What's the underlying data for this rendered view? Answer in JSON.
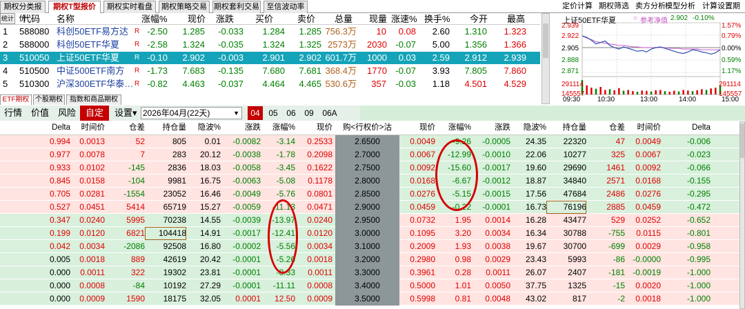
{
  "top_tabs": [
    "期权分类报价",
    "期权T型报价",
    "期权实时看盘",
    "期权策略交易",
    "期权套利交易",
    "至信波动率"
  ],
  "right_menu": [
    "定价计算",
    "期权筛选",
    "卖方分析",
    "模型分析",
    "计算设置",
    "期权交易"
  ],
  "side_tool": "统计",
  "quote_headers": [
    "代码",
    "名称",
    "涨幅%",
    "现价",
    "涨跌",
    "买价",
    "卖价",
    "总量",
    "现量",
    "涨速%",
    "换手%",
    "今开",
    "最高"
  ],
  "quote_rows": [
    {
      "idx": "1",
      "code": "588080",
      "name": "科创50ETF易方达",
      "r": "R",
      "chg_pct": "-2.50",
      "price": "1.285",
      "chg": "-0.033",
      "bid": "1.284",
      "ask": "1.285",
      "vol": "756.3万",
      "cur": "10",
      "speed": "0.08",
      "turn": "2.60",
      "open": "1.310",
      "high": "1.323"
    },
    {
      "idx": "2",
      "code": "588000",
      "name": "科创50ETF华夏",
      "r": "R",
      "chg_pct": "-2.58",
      "price": "1.324",
      "chg": "-0.035",
      "bid": "1.324",
      "ask": "1.325",
      "vol": "2573万",
      "cur": "2030",
      "speed": "-0.07",
      "turn": "5.00",
      "open": "1.356",
      "high": "1.366"
    },
    {
      "idx": "3",
      "code": "510050",
      "name": "上证50ETF华夏",
      "r": "R",
      "chg_pct": "-0.10",
      "price": "2.902",
      "chg": "-0.003",
      "bid": "2.901",
      "ask": "2.902",
      "vol": "601.7万",
      "cur": "1000",
      "speed": "0.03",
      "turn": "2.59",
      "open": "2.912",
      "high": "2.939"
    },
    {
      "idx": "4",
      "code": "510500",
      "name": "中证500ETF南方",
      "r": "R",
      "chg_pct": "-1.73",
      "price": "7.683",
      "chg": "-0.135",
      "bid": "7.680",
      "ask": "7.681",
      "vol": "368.4万",
      "cur": "1770",
      "speed": "-0.07",
      "turn": "3.93",
      "open": "7.805",
      "high": "7.860"
    },
    {
      "idx": "5",
      "code": "510300",
      "name": "沪深300ETF华泰…",
      "r": "R",
      "chg_pct": "-0.82",
      "price": "4.463",
      "chg": "-0.037",
      "bid": "4.464",
      "ask": "4.465",
      "vol": "530.6万",
      "cur": "357",
      "speed": "-0.03",
      "turn": "1.18",
      "open": "4.501",
      "high": "4.529"
    }
  ],
  "mini_chart": {
    "title": "上证50ETF华夏",
    "legend_label": "参考净值",
    "legend_value": "2.902",
    "legend_pct": "-0.10%",
    "y_left": [
      "2.939",
      "2.922",
      "2.905",
      "2.888",
      "2.871"
    ],
    "y_right": [
      "1.57%",
      "0.79%",
      "0.00%",
      "0.59%",
      "1.17%"
    ],
    "vol_left": [
      "291114",
      "145557"
    ],
    "vol_right": [
      "291114",
      "145557"
    ],
    "x_labels": [
      "09:30",
      "10:30",
      "13:00",
      "14:00",
      "15:00"
    ],
    "price_series": [
      2.921,
      2.919,
      2.915,
      2.91,
      2.912,
      2.914,
      2.908,
      2.905,
      2.903,
      2.906,
      2.904,
      2.902,
      2.9,
      2.901,
      2.899,
      2.903,
      2.905,
      2.906,
      2.904,
      2.902,
      2.9,
      2.898,
      2.897,
      2.899,
      2.902,
      2.901,
      2.899,
      2.898,
      2.896,
      2.898,
      2.902
    ],
    "avg_series": [
      2.921,
      2.918,
      2.916,
      2.913,
      2.912,
      2.911,
      2.91,
      2.909,
      2.908,
      2.908,
      2.907,
      2.906,
      2.906,
      2.905,
      2.905,
      2.905,
      2.905,
      2.905,
      2.905,
      2.904,
      2.904,
      2.904,
      2.903,
      2.903,
      2.903,
      2.903,
      2.902,
      2.902,
      2.902,
      2.902,
      2.902
    ],
    "prev_close": 2.905,
    "ymin": 2.871,
    "ymax": 2.939,
    "volume_series": [
      0.95,
      0.6,
      0.45,
      0.38,
      0.5,
      0.3,
      0.35,
      0.28,
      0.42,
      0.25,
      0.3,
      0.22,
      0.18,
      0.26,
      0.24,
      0.2,
      0.28,
      0.3,
      0.22,
      0.18,
      0.25,
      0.2,
      0.3,
      0.26,
      0.22,
      0.28,
      0.35,
      0.3,
      0.4,
      0.45,
      0.6
    ]
  },
  "bottom_tabs": [
    "ETF期权",
    "个股期权",
    "指数和商品期权"
  ],
  "toolbar": {
    "items": [
      "行情",
      "价值",
      "风险"
    ],
    "auto": "自定",
    "settings": "设置▾",
    "date": "2026年04月(22天)",
    "months": [
      "04",
      "05",
      "06",
      "09",
      "06A"
    ]
  },
  "table_headers": {
    "call": [
      "Delta",
      "时间价",
      "仓差",
      "持仓量",
      "隐波%",
      "涨跌",
      "涨幅%",
      "现价"
    ],
    "strike": "购<行权价>沽",
    "put": [
      "现价",
      "涨幅%",
      "涨跌",
      "隐波%",
      "持仓量",
      "仓差",
      "时间价",
      "Delta"
    ]
  },
  "option_rows": [
    {
      "c": [
        "0.994",
        "0.0013",
        "52",
        "805",
        "0.01",
        "-0.0082",
        "-3.14",
        "0.2533"
      ],
      "k": "2.6500",
      "p": [
        "0.0049",
        "-9.26",
        "-0.0005",
        "24.35",
        "22320",
        "47",
        "0.0049",
        "-0.006"
      ]
    },
    {
      "c": [
        "0.977",
        "0.0078",
        "7",
        "283",
        "20.12",
        "-0.0038",
        "-1.78",
        "0.2098"
      ],
      "k": "2.7000",
      "p": [
        "0.0067",
        "-12.99",
        "-0.0010",
        "22.06",
        "10277",
        "325",
        "0.0067",
        "-0.023"
      ]
    },
    {
      "c": [
        "0.933",
        "0.0102",
        "-145",
        "2836",
        "18.03",
        "-0.0058",
        "-3.45",
        "0.1622"
      ],
      "k": "2.7500",
      "p": [
        "0.0092",
        "-15.60",
        "-0.0017",
        "19.60",
        "29690",
        "1461",
        "0.0092",
        "-0.066"
      ]
    },
    {
      "c": [
        "0.845",
        "0.0158",
        "-104",
        "9981",
        "16.75",
        "-0.0063",
        "-5.08",
        "0.1178"
      ],
      "k": "2.8000",
      "p": [
        "0.0168",
        "-6.67",
        "-0.0012",
        "18.87",
        "34840",
        "2571",
        "0.0168",
        "-0.155"
      ]
    },
    {
      "c": [
        "0.705",
        "0.0281",
        "-1554",
        "23052",
        "16.46",
        "-0.0049",
        "-5.76",
        "0.0801"
      ],
      "k": "2.8500",
      "p": [
        "0.0276",
        "-5.15",
        "-0.0015",
        "17.56",
        "47684",
        "2486",
        "0.0276",
        "-0.295"
      ]
    },
    {
      "c": [
        "0.527",
        "0.0451",
        "5414",
        "65719",
        "15.27",
        "-0.0059",
        "-11.13",
        "0.0471"
      ],
      "k": "2.9000",
      "p": [
        "0.0459",
        "-0.22",
        "-0.0001",
        "16.73",
        "76196",
        "2885",
        "0.0459",
        "-0.472"
      ]
    },
    {
      "c": [
        "0.347",
        "0.0240",
        "5995",
        "70238",
        "14.55",
        "-0.0039",
        "-13.97",
        "0.0240"
      ],
      "k": "2.9500",
      "p": [
        "0.0732",
        "1.95",
        "0.0014",
        "16.28",
        "43477",
        "529",
        "0.0252",
        "-0.652"
      ]
    },
    {
      "c": [
        "0.199",
        "0.0120",
        "6821",
        "104418",
        "14.91",
        "-0.0017",
        "-12.41",
        "0.0120"
      ],
      "k": "3.0000",
      "p": [
        "0.1095",
        "3.20",
        "0.0034",
        "16.34",
        "30788",
        "-755",
        "0.0115",
        "-0.801"
      ]
    },
    {
      "c": [
        "0.042",
        "0.0034",
        "-2086",
        "92508",
        "16.80",
        "-0.0002",
        "-5.56",
        "0.0034"
      ],
      "k": "3.1000",
      "p": [
        "0.2009",
        "1.93",
        "0.0038",
        "19.67",
        "30700",
        "-699",
        "0.0029",
        "-0.958"
      ]
    },
    {
      "c": [
        "0.005",
        "0.0018",
        "889",
        "42619",
        "20.42",
        "-0.0001",
        "-5.26",
        "0.0018"
      ],
      "k": "3.2000",
      "p": [
        "0.2980",
        "0.98",
        "0.0029",
        "23.43",
        "5993",
        "-86",
        "-0.0000",
        "-0.995"
      ]
    },
    {
      "c": [
        "0.000",
        "0.0011",
        "322",
        "19302",
        "23.81",
        "-0.0001",
        "-8.33",
        "0.0011"
      ],
      "k": "3.3000",
      "p": [
        "0.3961",
        "0.28",
        "0.0011",
        "26.07",
        "2407",
        "-181",
        "-0.0019",
        "-1.000"
      ]
    },
    {
      "c": [
        "0.000",
        "0.0008",
        "-84",
        "10192",
        "27.29",
        "-0.0001",
        "-11.11",
        "0.0008"
      ],
      "k": "3.4000",
      "p": [
        "0.5000",
        "1.01",
        "0.0050",
        "37.75",
        "1325",
        "-15",
        "0.0020",
        "-1.000"
      ]
    },
    {
      "c": [
        "0.000",
        "0.0009",
        "1590",
        "18175",
        "32.05",
        "0.0001",
        "12.50",
        "0.0009"
      ],
      "k": "3.5000",
      "p": [
        "0.5998",
        "0.81",
        "0.0048",
        "43.02",
        "817",
        "-2",
        "0.0018",
        "-1.000"
      ]
    }
  ],
  "colors": {
    "itm_call": "#ffe4e1",
    "otm_call": "#d8f0dc",
    "strike_bg": "#8d9699",
    "annotation": "#d40000",
    "selected_row": "#14a3b8"
  }
}
